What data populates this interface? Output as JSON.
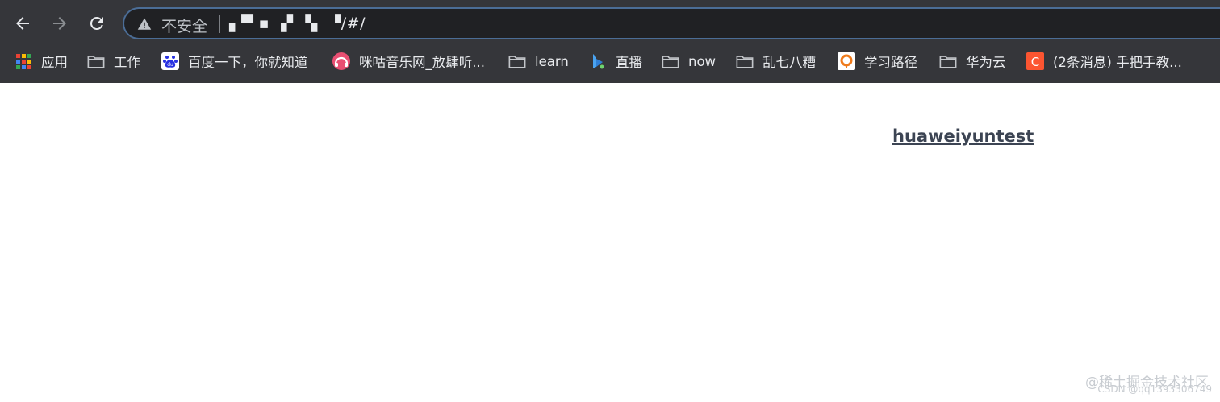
{
  "omnibox": {
    "security_label": "不安全",
    "url": "▖▀    ▪ ▗▘▝▖ ▝/#/"
  },
  "bookmarks": [
    {
      "label": "应用",
      "icon": "apps-grid-icon"
    },
    {
      "label": "工作",
      "icon": "folder-icon"
    },
    {
      "label": "百度一下，你就知道",
      "icon": "baidu-icon"
    },
    {
      "label": "咪咕音乐网_放肆听...",
      "icon": "migu-icon"
    },
    {
      "label": "learn",
      "icon": "folder-icon"
    },
    {
      "label": "直播",
      "icon": "bilibili-icon"
    },
    {
      "label": "now",
      "icon": "folder-icon"
    },
    {
      "label": "乱七八糟",
      "icon": "folder-icon"
    },
    {
      "label": "学习路径",
      "icon": "learning-path-icon"
    },
    {
      "label": "华为云",
      "icon": "folder-icon"
    },
    {
      "label": "(2条消息) 手把手教...",
      "icon": "csdn-icon"
    }
  ],
  "page": {
    "link_text": "huaweiyuntest"
  },
  "watermark": {
    "main": "@稀土掘金技术社区",
    "sub": "CSDN @qq1393306749"
  },
  "colors": {
    "toolbar_bg": "#35363a",
    "omnibox_bg": "#202124",
    "omnibox_focus_border": "#4b6d96",
    "link": "#3c4453"
  }
}
